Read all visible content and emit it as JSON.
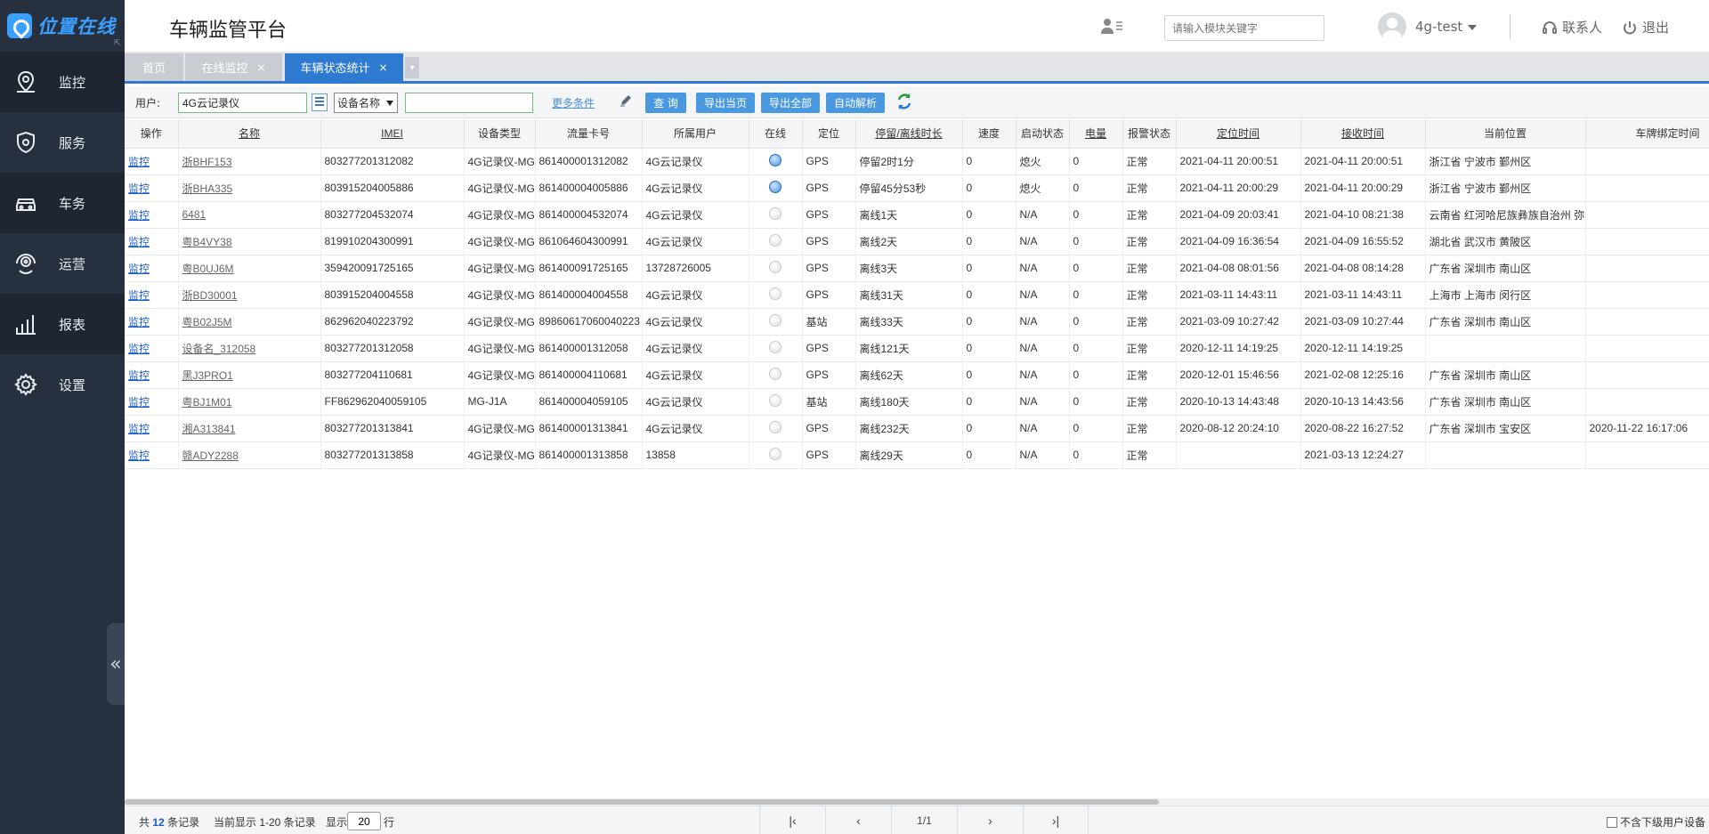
{
  "app": {
    "logo_text": "位置在线",
    "title": "车辆监管平台"
  },
  "sidebar": {
    "items": [
      {
        "label": "监控",
        "icon": "location-pin-icon"
      },
      {
        "label": "服务",
        "icon": "shield-icon"
      },
      {
        "label": "车务",
        "icon": "car-icon"
      },
      {
        "label": "运营",
        "icon": "operations-icon"
      },
      {
        "label": "报表",
        "icon": "bar-chart-icon"
      },
      {
        "label": "设置",
        "icon": "gear-icon"
      }
    ],
    "collapse_glyph": "«"
  },
  "header": {
    "search_placeholder": "请输入模块关键字",
    "user": "4g-test",
    "contact": "联系人",
    "logout": "退出"
  },
  "tabs": [
    {
      "label": "首页",
      "closable": false,
      "active": false
    },
    {
      "label": "在线监控",
      "closable": true,
      "active": false
    },
    {
      "label": "车辆状态统计",
      "closable": true,
      "active": true
    }
  ],
  "tab_close_glyph": "×",
  "toolbar": {
    "user_label": "用户:",
    "user_value": "4G云记录仪",
    "field_select": "设备名称",
    "search_value": "",
    "more_conditions": "更多条件",
    "query": "查 询",
    "export_page": "导出当页",
    "export_all": "导出全部",
    "auto_parse": "自动解析"
  },
  "table": {
    "columns": [
      "操作",
      "名称",
      "IMEI",
      "设备类型",
      "流量卡号",
      "所属用户",
      "在线",
      "定位",
      "停留/离线时长",
      "速度",
      "启动状态",
      "电量",
      "报警状态",
      "定位时间",
      "接收时间",
      "当前位置",
      "车牌绑定时间"
    ],
    "rows": [
      [
        "监控",
        "浙BHF153",
        "803277201312082",
        "4G记录仪-MG",
        "861400001312082",
        "4G云记录仪",
        "on",
        "GPS",
        "停留2时1分",
        "0",
        "熄火",
        "0",
        "正常",
        "2021-04-11 20:00:51",
        "2021-04-11 20:00:51",
        "浙江省 宁波市 鄞州区",
        ""
      ],
      [
        "监控",
        "浙BHA335",
        "803915204005886",
        "4G记录仪-MG",
        "861400004005886",
        "4G云记录仪",
        "on",
        "GPS",
        "停留45分53秒",
        "0",
        "熄火",
        "0",
        "正常",
        "2021-04-11 20:00:29",
        "2021-04-11 20:00:29",
        "浙江省 宁波市 鄞州区",
        ""
      ],
      [
        "监控",
        "6481",
        "803277204532074",
        "4G记录仪-MG",
        "861400004532074",
        "4G云记录仪",
        "off",
        "GPS",
        "离线1天",
        "0",
        "N/A",
        "0",
        "正常",
        "2021-04-09 20:03:41",
        "2021-04-10 08:21:38",
        "云南省 红河哈尼族彝族自治州 弥",
        ""
      ],
      [
        "监控",
        "粤B4VY38",
        "819910204300991",
        "4G记录仪-MG",
        "861064604300991",
        "4G云记录仪",
        "off",
        "GPS",
        "离线2天",
        "0",
        "N/A",
        "0",
        "正常",
        "2021-04-09 16:36:54",
        "2021-04-09 16:55:52",
        "湖北省 武汉市 黄陂区",
        ""
      ],
      [
        "监控",
        "粤B0UJ6M",
        "359420091725165",
        "4G记录仪-MG",
        "861400091725165",
        "13728726005",
        "off",
        "GPS",
        "离线3天",
        "0",
        "N/A",
        "0",
        "正常",
        "2021-04-08 08:01:56",
        "2021-04-08 08:14:28",
        "广东省 深圳市 南山区",
        ""
      ],
      [
        "监控",
        "浙BD30001",
        "803915204004558",
        "4G记录仪-MG",
        "861400004004558",
        "4G云记录仪",
        "off",
        "GPS",
        "离线31天",
        "0",
        "N/A",
        "0",
        "正常",
        "2021-03-11 14:43:11",
        "2021-03-11 14:43:11",
        "上海市 上海市 闵行区",
        ""
      ],
      [
        "监控",
        "粤B02J5M",
        "862962040223792",
        "4G记录仪-MG",
        "89860617060040223",
        "4G云记录仪",
        "off",
        "基站",
        "离线33天",
        "0",
        "N/A",
        "0",
        "正常",
        "2021-03-09 10:27:42",
        "2021-03-09 10:27:44",
        "广东省 深圳市 南山区",
        ""
      ],
      [
        "监控",
        "设备名_312058",
        "803277201312058",
        "4G记录仪-MG",
        "861400001312058",
        "4G云记录仪",
        "off",
        "GPS",
        "离线121天",
        "0",
        "N/A",
        "0",
        "正常",
        "2020-12-11 14:19:25",
        "2020-12-11 14:19:25",
        "",
        ""
      ],
      [
        "监控",
        "黑J3PRO1",
        "803277204110681",
        "4G记录仪-MG",
        "861400004110681",
        "4G云记录仪",
        "off",
        "GPS",
        "离线62天",
        "0",
        "N/A",
        "0",
        "正常",
        "2020-12-01 15:46:56",
        "2021-02-08 12:25:16",
        "广东省 深圳市 南山区",
        ""
      ],
      [
        "监控",
        "粤BJ1M01",
        "FF862962040059105",
        "MG-J1A",
        "861400004059105",
        "4G云记录仪",
        "off",
        "基站",
        "离线180天",
        "0",
        "N/A",
        "0",
        "正常",
        "2020-10-13 14:43:48",
        "2020-10-13 14:43:56",
        "广东省 深圳市 南山区",
        ""
      ],
      [
        "监控",
        "湘A313841",
        "803277201313841",
        "4G记录仪-MG",
        "861400001313841",
        "4G云记录仪",
        "off",
        "GPS",
        "离线232天",
        "0",
        "N/A",
        "0",
        "正常",
        "2020-08-12 20:24:10",
        "2020-08-22 16:27:52",
        "广东省 深圳市 宝安区",
        "2020-11-22 16:17:06"
      ],
      [
        "监控",
        "赣ADY2288",
        "803277201313858",
        "4G记录仪-MG",
        "861400001313858",
        "13858",
        "off",
        "GPS",
        "离线29天",
        "0",
        "N/A",
        "0",
        "正常",
        "",
        "2021-03-13 12:24:27",
        "",
        ""
      ]
    ]
  },
  "footer": {
    "total_prefix": "共",
    "total_count": "12",
    "total_suffix": "条记录",
    "current_display": "当前显示 1-20 条记录",
    "show_label": "显示",
    "page_size": "20",
    "rows_suffix": "行",
    "page_indicator": "1/1",
    "exclude_sub_users": "不含下级用户设备"
  },
  "colors": {
    "sidebar_bg": "#27303f",
    "accent": "#2f7ad1",
    "button": "#4a98e0",
    "link": "#1a5cc7"
  }
}
